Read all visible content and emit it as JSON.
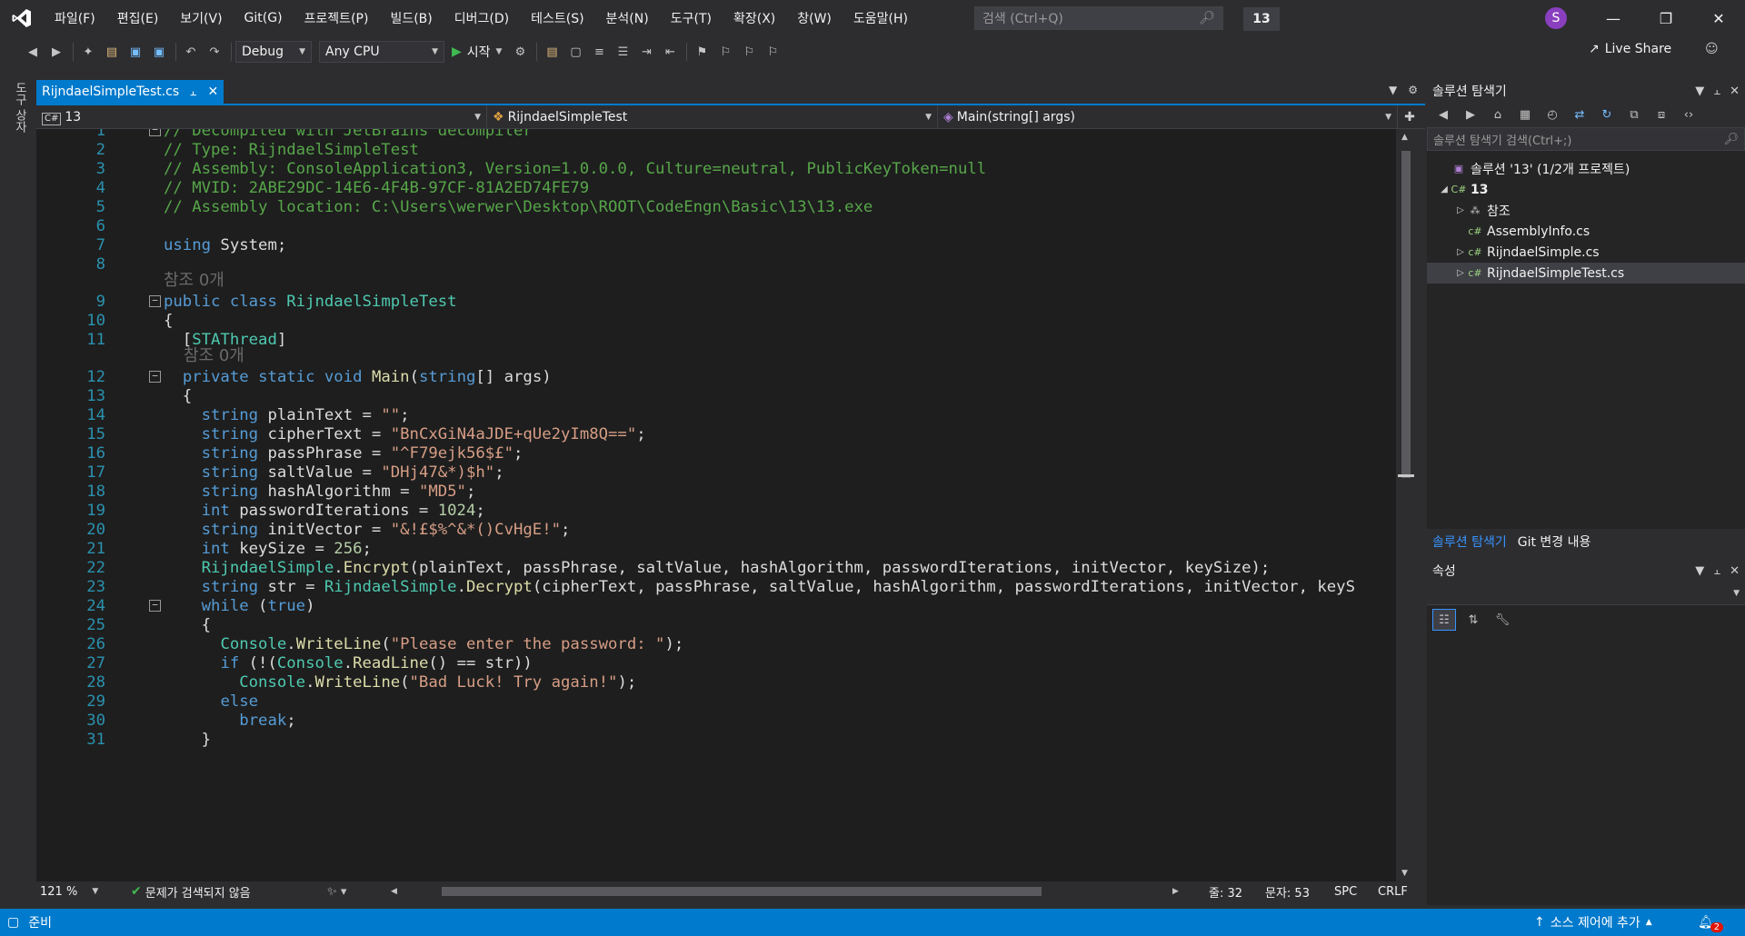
{
  "menu": [
    "파일(F)",
    "편집(E)",
    "보기(V)",
    "Git(G)",
    "프로젝트(P)",
    "빌드(B)",
    "디버그(D)",
    "테스트(S)",
    "분석(N)",
    "도구(T)",
    "확장(X)",
    "창(W)",
    "도움말(H)"
  ],
  "search": {
    "placeholder": "검색 (Ctrl+Q)"
  },
  "solution_badge": "13",
  "avatar_letter": "S",
  "toolbar": {
    "config": "Debug",
    "platform": "Any CPU",
    "start_label": "시작",
    "liveshare_label": "Live Share"
  },
  "toolbox_label": "도구 상자",
  "doc_tab": {
    "name": "RijndaelSimpleTest.cs"
  },
  "navbar": {
    "project": "13",
    "class": "RijndaelSimpleTest",
    "member": "Main(string[] args)"
  },
  "hints": {
    "refs": "참조 0개"
  },
  "code": {
    "line_numbers": [
      "1",
      "2",
      "3",
      "4",
      "5",
      "6",
      "7",
      "8",
      "9",
      "10",
      "11",
      "12",
      "13",
      "14",
      "15",
      "16",
      "17",
      "18",
      "19",
      "20",
      "21",
      "22",
      "23",
      "24",
      "25",
      "26",
      "27",
      "28",
      "29",
      "30",
      "31"
    ],
    "lines": [
      "// Decompiled with JetBrains decompiler",
      "// Type: RijndaelSimpleTest",
      "// Assembly: ConsoleApplication3, Version=1.0.0.0, Culture=neutral, PublicKeyToken=null",
      "// MVID: 2ABE29DC-14E6-4F4B-97CF-81A2ED74FE79",
      "// Assembly location: C:\\Users\\werwer\\Desktop\\ROOT\\CodeEngn\\Basic\\13\\13.exe",
      "",
      "using System;",
      "",
      "public class RijndaelSimpleTest",
      "{",
      "  [STAThread]",
      "  private static void Main(string[] args)",
      "  {",
      "    string plainText = \"\";",
      "    string cipherText = \"BnCxGiN4aJDE+qUe2yIm8Q==\";",
      "    string passPhrase = \"^F79ejk56$£\";",
      "    string saltValue = \"DHj47&*)$h\";",
      "    string hashAlgorithm = \"MD5\";",
      "    int passwordIterations = 1024;",
      "    string initVector = \"&!£$%^&*()CvHgE!\";",
      "    int keySize = 256;",
      "    RijndaelSimple.Encrypt(plainText, passPhrase, saltValue, hashAlgorithm, passwordIterations, initVector, keySize);",
      "    string str = RijndaelSimple.Decrypt(cipherText, passPhrase, saltValue, hashAlgorithm, passwordIterations, initVector, keyS",
      "    while (true)",
      "    {",
      "      Console.WriteLine(\"Please enter the password: \");",
      "      if (!(Console.ReadLine() == str))",
      "        Console.WriteLine(\"Bad Luck! Try again!\");",
      "      else",
      "        break;",
      "    }"
    ]
  },
  "editor_status": {
    "zoom": "121 %",
    "issues": "문제가 검색되지 않음",
    "line": "줄: 32",
    "col": "문자: 53",
    "spc": "SPC",
    "eol": "CRLF"
  },
  "solution_explorer": {
    "title": "솔루션 탐색기",
    "search_placeholder": "솔루션 탐색기 검색(Ctrl+;)",
    "nodes": [
      {
        "label": "솔루션 '13' (1/2개 프로젝트)",
        "icon": "solution-icon"
      },
      {
        "label": "13",
        "icon": "csharp-project-icon"
      },
      {
        "label": "참조",
        "icon": "references-icon"
      },
      {
        "label": "AssemblyInfo.cs",
        "icon": "csharp-file-icon"
      },
      {
        "label": "RijndaelSimple.cs",
        "icon": "csharp-file-icon"
      },
      {
        "label": "RijndaelSimpleTest.cs",
        "icon": "csharp-file-icon"
      }
    ],
    "tabs": [
      "솔루션 탐색기",
      "Git 변경 내용"
    ]
  },
  "properties": {
    "title": "속성"
  },
  "statusbar": {
    "ready": "준비",
    "source_control": "소스 제어에 추가",
    "notifications": "2"
  },
  "colors": {
    "accent": "#007acc",
    "comment": "#57a64a",
    "keyword": "#569cd6",
    "type": "#4ec9b0",
    "string": "#d69d85",
    "number": "#b5cea8",
    "method": "#dcdcaa"
  }
}
